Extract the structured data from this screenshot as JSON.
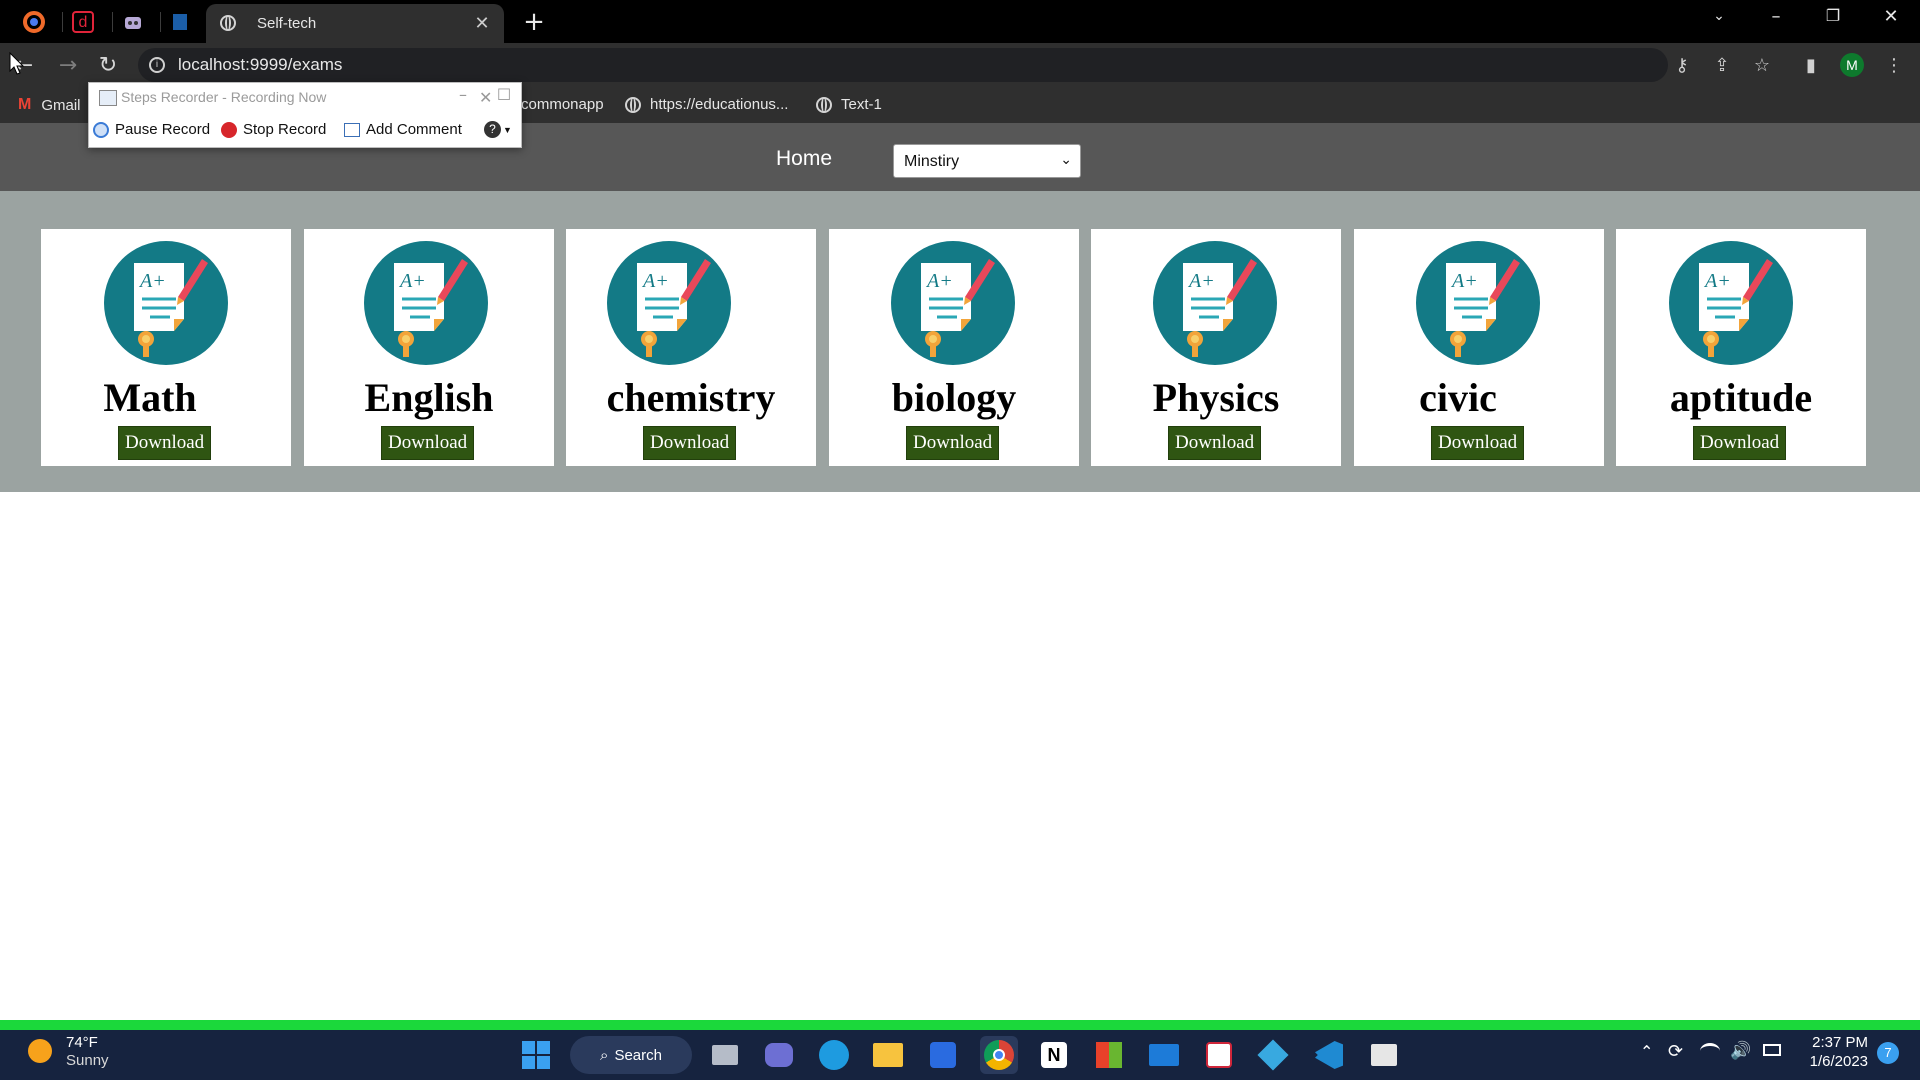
{
  "browser": {
    "active_tab_title": "Self-tech",
    "url": "localhost:9999/exams",
    "profile_initial": "M",
    "bookmarks": [
      "Gmail",
      "commonapp",
      "https://educationus...",
      "Text-1"
    ]
  },
  "steps_recorder": {
    "title": "Steps Recorder - Recording Now",
    "pause": "Pause Record",
    "stop": "Stop Record",
    "comment": "Add Comment"
  },
  "nav": {
    "home": "Home",
    "select_value": "Minstiry"
  },
  "cards": [
    {
      "name": "Math",
      "button": "Download"
    },
    {
      "name": "English",
      "button": "Download"
    },
    {
      "name": "chemistry",
      "button": "Download"
    },
    {
      "name": "biology",
      "button": "Download"
    },
    {
      "name": "Physics",
      "button": "Download"
    },
    {
      "name": "civic",
      "button": "Download"
    },
    {
      "name": "aptitude",
      "button": "Download"
    }
  ],
  "taskbar": {
    "temperature": "74°F",
    "weather": "Sunny",
    "search": "Search",
    "time": "2:37 PM",
    "date": "1/6/2023",
    "notification_count": "7"
  },
  "colors": {
    "download_button": "#2f5512",
    "icon_circle": "#137a86",
    "band": "#9ba3a1",
    "nav": "#575757"
  }
}
